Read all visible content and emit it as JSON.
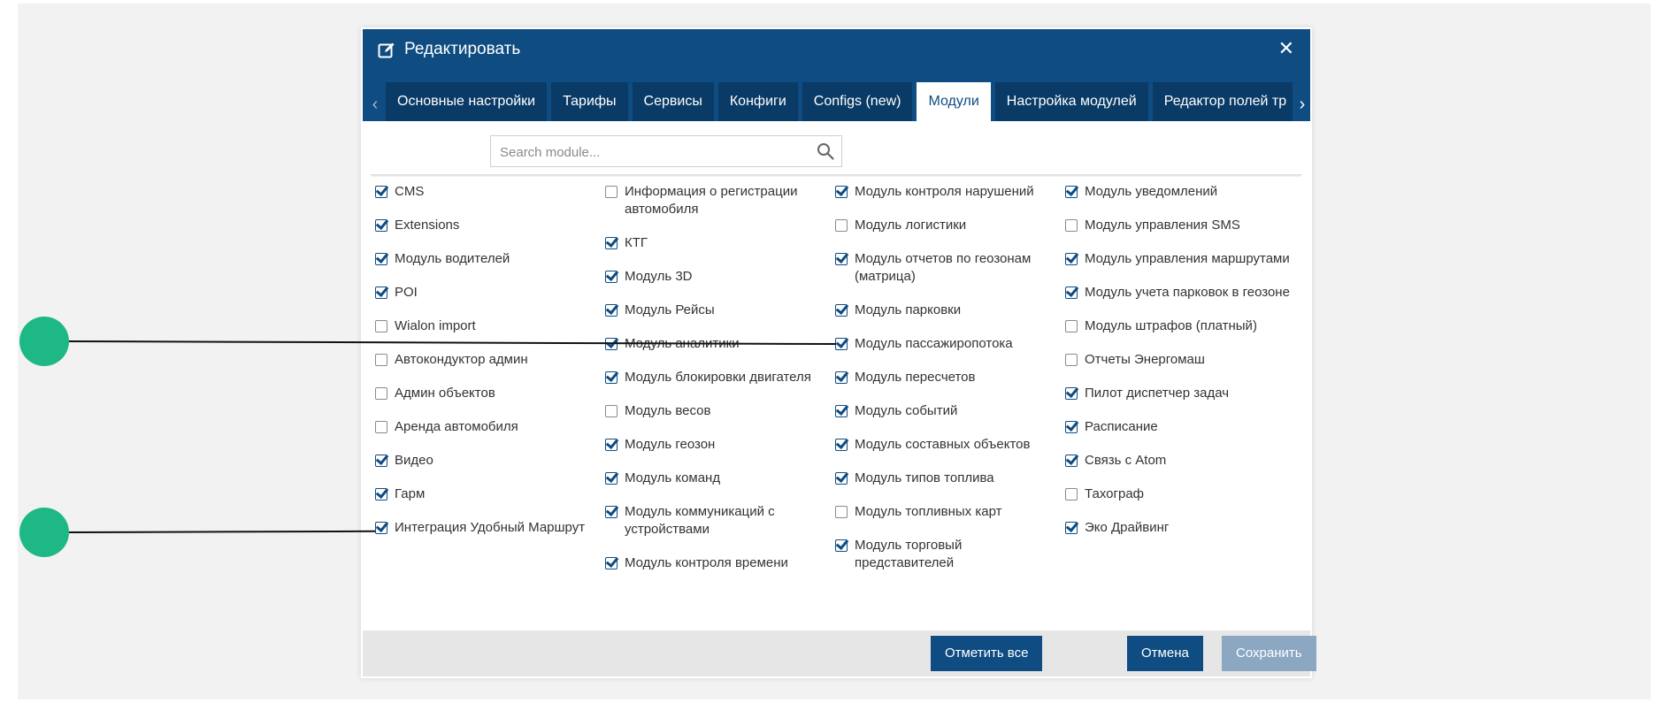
{
  "dialog": {
    "title": "Редактировать",
    "close": "✕",
    "tabs": [
      {
        "label": "Основные настройки",
        "active": false
      },
      {
        "label": "Тарифы",
        "active": false
      },
      {
        "label": "Сервисы",
        "active": false
      },
      {
        "label": "Конфиги",
        "active": false
      },
      {
        "label": "Configs (new)",
        "active": false
      },
      {
        "label": "Модули",
        "active": true
      },
      {
        "label": "Настройка модулей",
        "active": false
      },
      {
        "label": "Редактор полей тр",
        "active": false
      }
    ],
    "tab_prev": "‹",
    "tab_next": "›",
    "search_placeholder": "Search module...",
    "columns": [
      [
        {
          "label": "CMS",
          "checked": true
        },
        {
          "label": "Extensions",
          "checked": true
        },
        {
          "label": "Модуль водителей",
          "checked": true
        },
        {
          "label": "POI",
          "checked": true
        },
        {
          "label": "Wialon import",
          "checked": false
        },
        {
          "label": "Автокондуктор админ",
          "checked": false
        },
        {
          "label": "Админ объектов",
          "checked": false
        },
        {
          "label": "Аренда автомобиля",
          "checked": false
        },
        {
          "label": "Видео",
          "checked": true
        },
        {
          "label": "Гарм",
          "checked": true
        },
        {
          "label": "Интеграция Удобный Маршрут",
          "checked": true
        }
      ],
      [
        {
          "label": "Информация о регистрации автомобиля",
          "checked": false
        },
        {
          "label": "КТГ",
          "checked": true
        },
        {
          "label": "Модуль 3D",
          "checked": true
        },
        {
          "label": "Модуль Рейсы",
          "checked": true
        },
        {
          "label": "Модуль аналитики",
          "checked": true
        },
        {
          "label": "Модуль блокировки двигателя",
          "checked": true
        },
        {
          "label": "Модуль весов",
          "checked": false
        },
        {
          "label": "Модуль геозон",
          "checked": true
        },
        {
          "label": "Модуль команд",
          "checked": true
        },
        {
          "label": "Модуль коммуникаций с устройствами",
          "checked": true
        },
        {
          "label": "Модуль контроля времени",
          "checked": true
        }
      ],
      [
        {
          "label": "Модуль контроля нарушений",
          "checked": true
        },
        {
          "label": "Модуль логистики",
          "checked": false
        },
        {
          "label": "Модуль отчетов по геозонам (матрица)",
          "checked": true
        },
        {
          "label": "Модуль парковки",
          "checked": true
        },
        {
          "label": "Модуль пассажиропотока",
          "checked": true
        },
        {
          "label": "Модуль пересчетов",
          "checked": true
        },
        {
          "label": "Модуль событий",
          "checked": true
        },
        {
          "label": "Модуль составных объектов",
          "checked": true
        },
        {
          "label": "Модуль типов топлива",
          "checked": true
        },
        {
          "label": "Модуль топливных карт",
          "checked": false
        },
        {
          "label": "Модуль торговый представителей",
          "checked": true
        }
      ],
      [
        {
          "label": "Модуль уведомлений",
          "checked": true
        },
        {
          "label": "Модуль управления SMS",
          "checked": false
        },
        {
          "label": "Модуль управления маршрутами",
          "checked": true
        },
        {
          "label": "Модуль учета парковок в геозоне",
          "checked": true
        },
        {
          "label": "Модуль штрафов (платный)",
          "checked": false
        },
        {
          "label": "Отчеты Энергомаш",
          "checked": false
        },
        {
          "label": "Пилот диспетчер задач",
          "checked": true
        },
        {
          "label": "Расписание",
          "checked": true
        },
        {
          "label": "Связь с Atom",
          "checked": true
        },
        {
          "label": "Тахограф",
          "checked": false
        },
        {
          "label": "Эко Драйвинг",
          "checked": true
        }
      ]
    ],
    "buttons": {
      "select_all": "Отметить все",
      "cancel": "Отмена",
      "save": "Сохранить"
    }
  },
  "colors": {
    "accent": "#0f4c81",
    "tab_inactive": "#0a3a66",
    "callout": "#1db885",
    "save_disabled": "#8ba7c2"
  }
}
